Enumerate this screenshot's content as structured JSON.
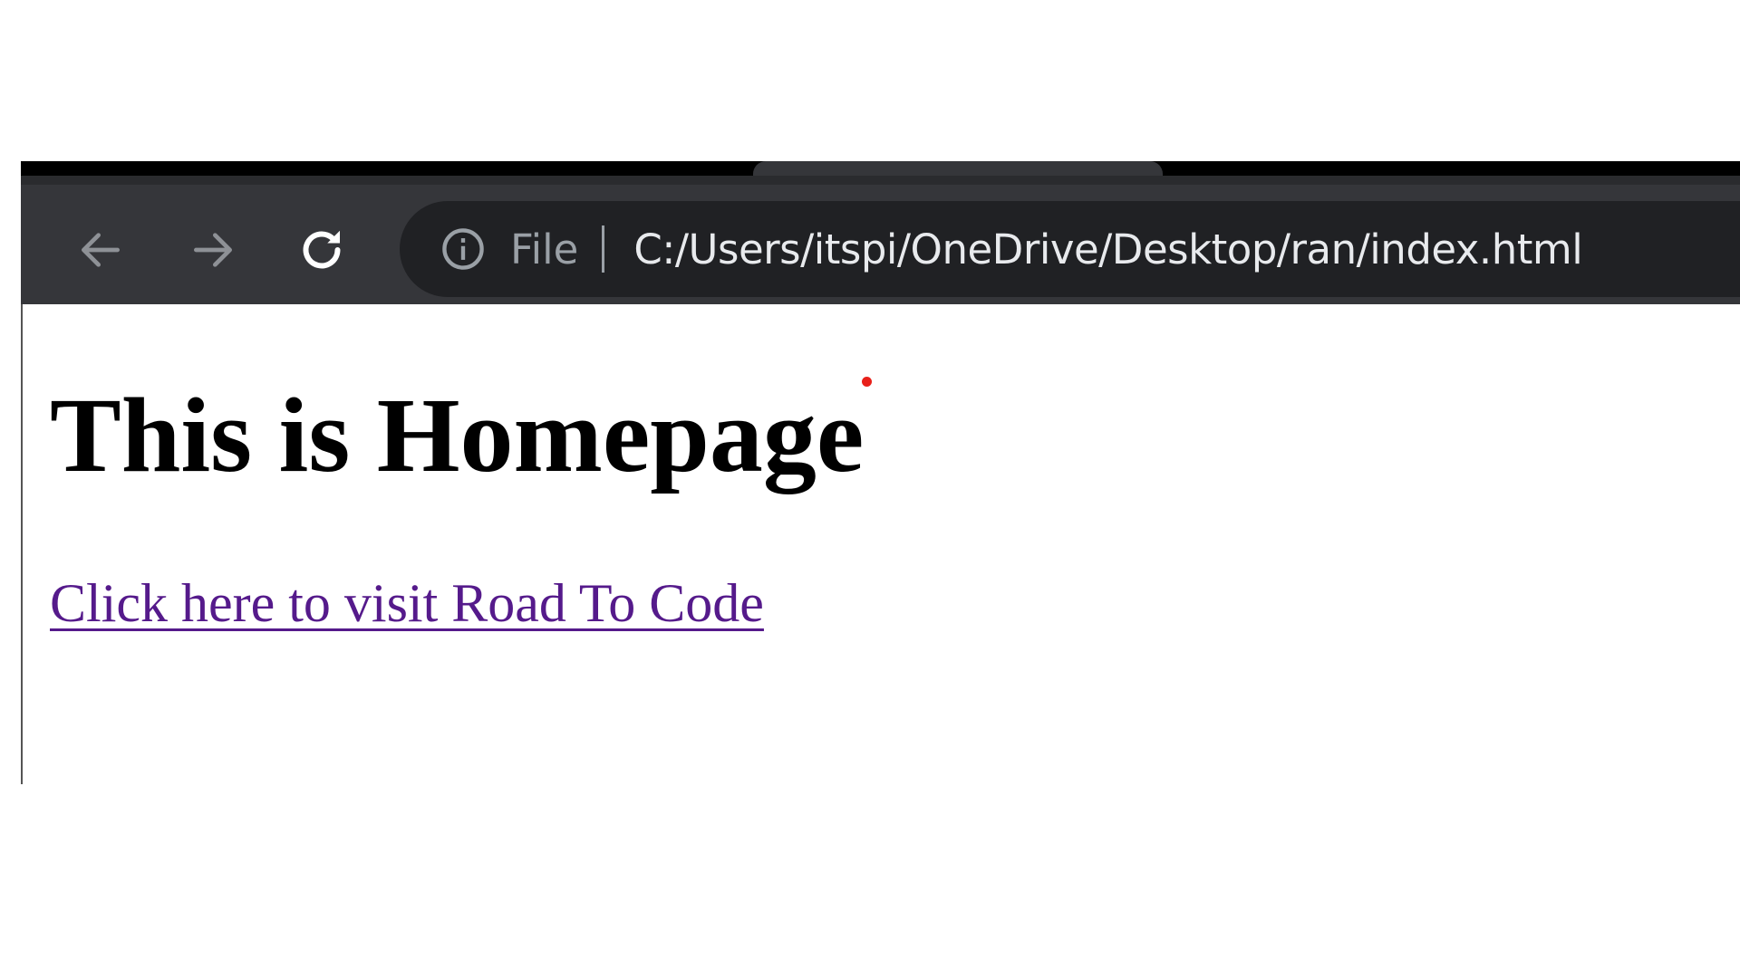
{
  "browser": {
    "toolbar": {
      "back_icon": "arrow-left-icon",
      "forward_icon": "arrow-right-icon",
      "reload_icon": "reload-icon"
    },
    "omnibox": {
      "info_icon": "info-circle-icon",
      "scheme_label": "File",
      "url": "C:/Users/itspi/OneDrive/Desktop/ran/index.html"
    }
  },
  "page": {
    "heading": "This is Homepage",
    "link_text": "Click here to visit Road To Code"
  },
  "colors": {
    "toolbar_bg": "#35363a",
    "omnibox_bg": "#202124",
    "url_text": "#e8eaed",
    "link_visited": "#551a8b",
    "cursor_dot": "#e8201a"
  }
}
